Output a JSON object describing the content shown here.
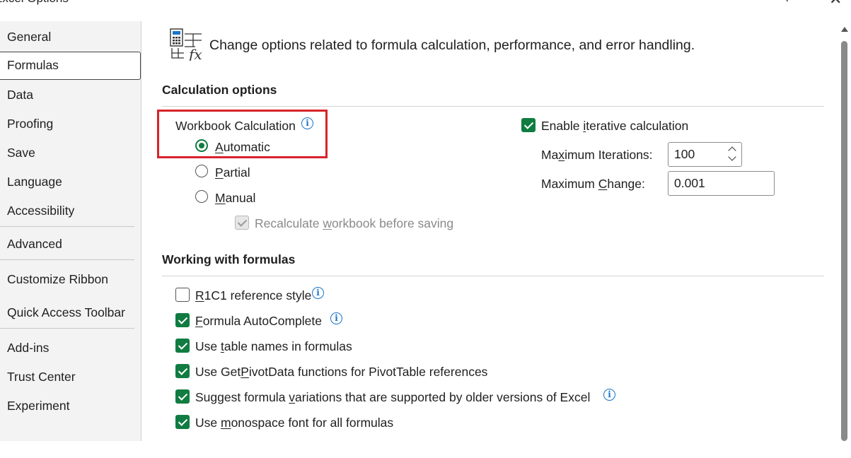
{
  "window": {
    "title": "Excel Options",
    "help_glyph": "?",
    "close_glyph": "✕"
  },
  "sidebar": {
    "items": [
      {
        "label": "General"
      },
      {
        "label": "Formulas",
        "selected": true
      },
      {
        "label": "Data"
      },
      {
        "label": "Proofing"
      },
      {
        "label": "Save"
      },
      {
        "label": "Language"
      },
      {
        "label": "Accessibility"
      },
      {
        "label": "Advanced"
      },
      {
        "label": "Customize Ribbon"
      },
      {
        "label": "Quick Access Toolbar"
      },
      {
        "label": "Add-ins"
      },
      {
        "label": "Trust Center"
      },
      {
        "label": "Experiment"
      }
    ]
  },
  "header": {
    "description": "Change options related to formula calculation, performance, and error handling.",
    "icon": "formula-calculator-icon"
  },
  "calculation": {
    "section_title": "Calculation options",
    "workbook_calculation_label": "Workbook Calculation",
    "automatic": {
      "pre": "",
      "key": "A",
      "post": "utomatic",
      "checked": true
    },
    "partial": {
      "pre": "",
      "key": "P",
      "post": "artial",
      "checked": false
    },
    "manual": {
      "pre": "",
      "key": "M",
      "post": "anual",
      "checked": false
    },
    "recalculate": {
      "pre": "Recalculate ",
      "key": "w",
      "post": "orkbook before saving",
      "checked": true,
      "disabled": true
    },
    "iterative": {
      "pre": "Enable ",
      "key": "i",
      "post": "terative calculation",
      "checked": true
    },
    "max_iterations": {
      "pre": "Ma",
      "key": "x",
      "post": "imum Iterations:",
      "value": "100"
    },
    "max_change": {
      "pre": "Maximum ",
      "key": "C",
      "post": "hange:",
      "value": "0.001"
    }
  },
  "formulas": {
    "section_title": "Working with formulas",
    "options": [
      {
        "pre": "",
        "key": "R",
        "post": "1C1 reference style",
        "checked": false,
        "info": true
      },
      {
        "pre": "",
        "key": "F",
        "post": "ormula AutoComplete",
        "checked": true,
        "info": true
      },
      {
        "pre": "Use ",
        "key": "t",
        "post": "able names in formulas",
        "checked": true,
        "info": false
      },
      {
        "pre": "Use Get",
        "key": "P",
        "post": "ivotData functions for PivotTable references",
        "checked": true,
        "info": false
      },
      {
        "pre": "Suggest formula ",
        "key": "v",
        "post": "ariations that are supported by older versions of Excel",
        "checked": true,
        "info": true
      },
      {
        "pre": "Use ",
        "key": "m",
        "post": "onospace font for all formulas",
        "checked": true,
        "info": false
      }
    ]
  },
  "colors": {
    "accent_green": "#107c41",
    "highlight_red": "#d8232a",
    "info_blue": "#1a73c8"
  }
}
